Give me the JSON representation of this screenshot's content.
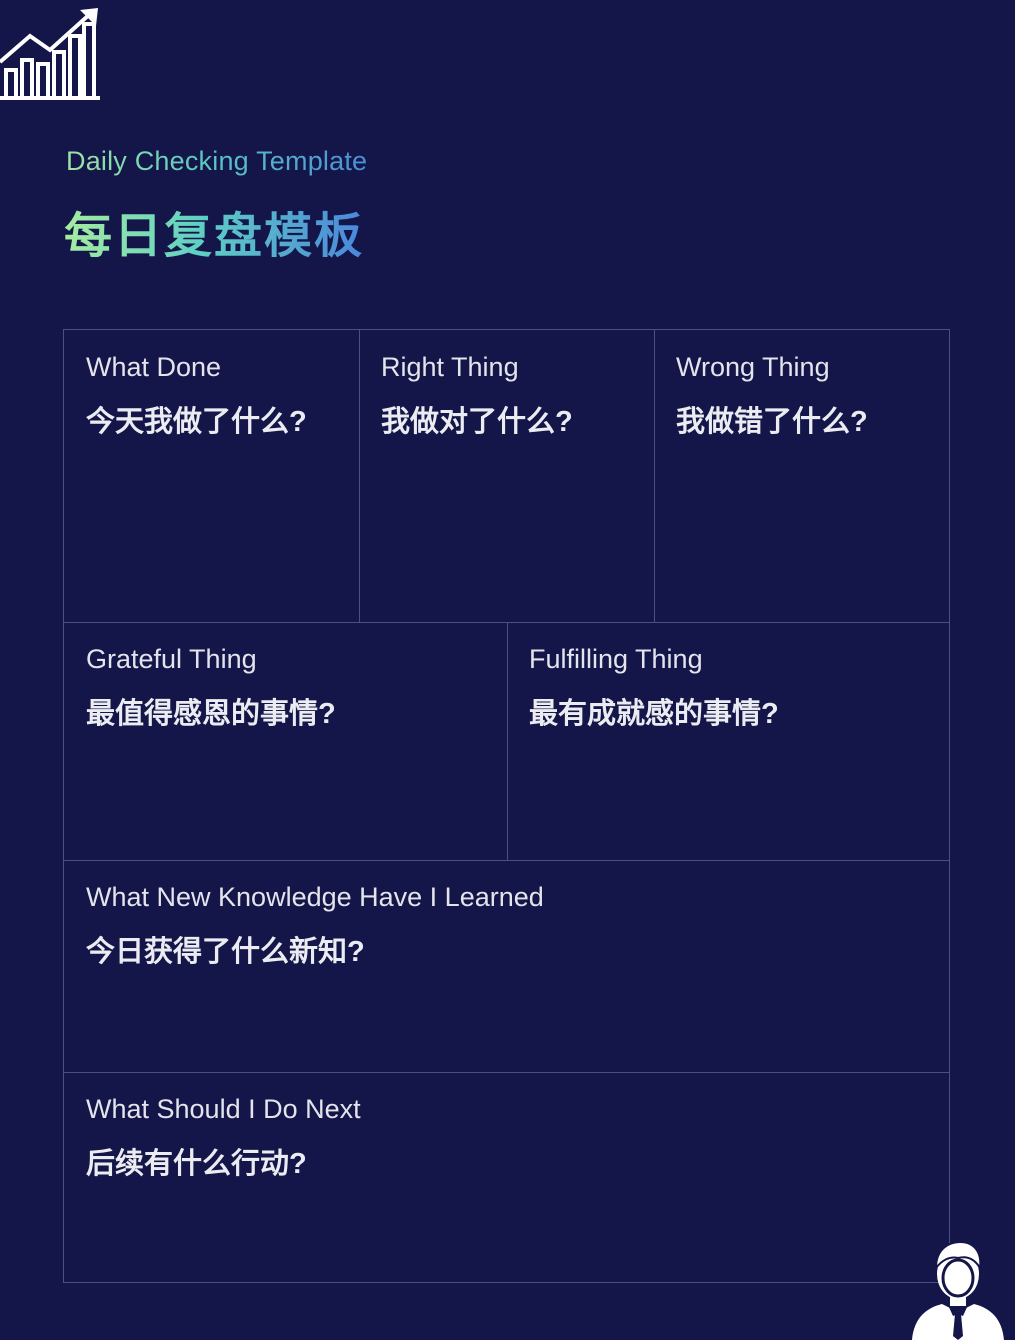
{
  "header": {
    "subtitle": "Daily Checking Template",
    "title": "每日复盘模板",
    "logo_icon": "growth-chart-icon"
  },
  "sections": [
    {
      "label": "What Done",
      "question": "今天我做了什么?"
    },
    {
      "label": "Right Thing",
      "question": "我做对了什么?"
    },
    {
      "label": "Wrong Thing",
      "question": "我做错了什么?"
    },
    {
      "label": "Grateful Thing",
      "question": "最值得感恩的事情?"
    },
    {
      "label": "Fulfilling Thing",
      "question": "最有成就感的事情?"
    },
    {
      "label": "What New Knowledge Have I Learned",
      "question": "今日获得了什么新知?"
    },
    {
      "label": "What Should I Do Next",
      "question": "后续有什么行动?"
    }
  ],
  "footer": {
    "avatar_icon": "businessman-icon"
  },
  "colors": {
    "background": "#141548",
    "grid_line": "#4c4f82",
    "title_gradient_start": "#a6eca0",
    "title_gradient_end": "#4b86db"
  }
}
